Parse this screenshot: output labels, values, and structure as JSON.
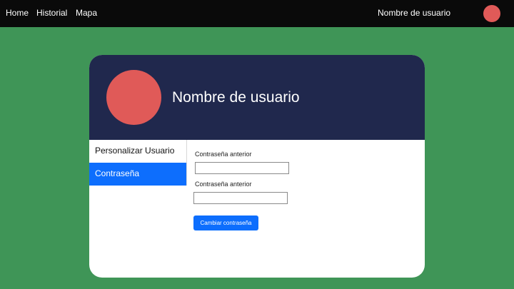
{
  "colors": {
    "page_background": "#3f9557",
    "topbar_background": "#0a0a0a",
    "card_header_background": "#20284d",
    "avatar_color": "#e05a58",
    "accent_blue": "#0d6efd"
  },
  "topbar": {
    "links": [
      "Home",
      "Historial",
      "Mapa"
    ],
    "username": "Nombre de usuario"
  },
  "profile": {
    "name": "Nombre de usuario"
  },
  "side_menu": {
    "items": [
      "Personalizar Usuario",
      "Contraseña"
    ],
    "active": "Contraseña"
  },
  "form": {
    "fields": [
      {
        "label": "Contraseña anterior",
        "value": ""
      },
      {
        "label": "Contraseña anterior",
        "value": ""
      }
    ],
    "submit_label": "Cambiar contraseña"
  }
}
